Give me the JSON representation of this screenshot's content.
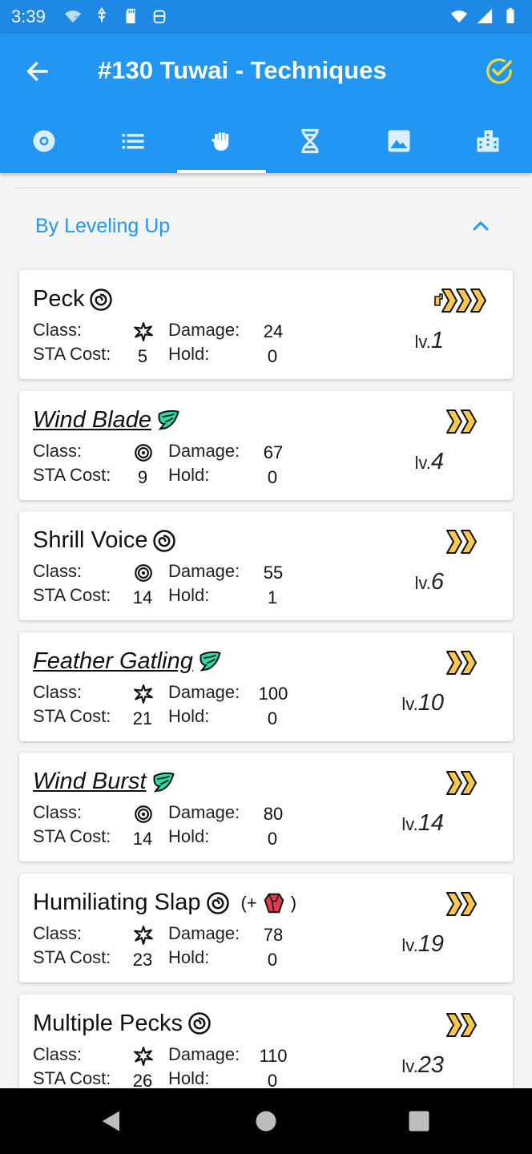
{
  "status_bar": {
    "time": "3:39",
    "icons_left": [
      "wifi-question-icon",
      "usb-debug-icon",
      "sd-card-icon",
      "android-icon"
    ],
    "icons_right": [
      "wifi-signal-icon",
      "cell-signal-icon",
      "battery-icon"
    ]
  },
  "app_bar": {
    "title": "#130 Tuwai - Techniques",
    "back_icon": "arrow-back-icon",
    "action_icon": "check-circle-icon",
    "accent_color": "#FDD835"
  },
  "tabs": [
    {
      "icon": "pokeball-icon",
      "active": false
    },
    {
      "icon": "list-icon",
      "active": false
    },
    {
      "icon": "fist-icon",
      "active": true
    },
    {
      "icon": "dna-icon",
      "active": false
    },
    {
      "icon": "image-icon",
      "active": false
    },
    {
      "icon": "building-icon",
      "active": false
    }
  ],
  "section": {
    "title": "By Leveling Up",
    "expanded": true
  },
  "labels": {
    "class": "Class:",
    "damage": "Damage:",
    "sta_cost": "STA Cost:",
    "hold": "Hold:",
    "level_prefix": "lv."
  },
  "techniques": [
    {
      "name": "Peck",
      "italic": false,
      "type": "wind",
      "extra": null,
      "class": "physical",
      "damage": "24",
      "sta_cost": "5",
      "hold": "0",
      "level": "1",
      "priority": "fast"
    },
    {
      "name": "Wind Blade",
      "italic": true,
      "type": "wind-green",
      "extra": null,
      "class": "special",
      "damage": "67",
      "sta_cost": "9",
      "hold": "0",
      "level": "4",
      "priority": "normal"
    },
    {
      "name": "Shrill Voice",
      "italic": false,
      "type": "wind",
      "extra": null,
      "class": "special",
      "damage": "55",
      "sta_cost": "14",
      "hold": "1",
      "level": "6",
      "priority": "normal"
    },
    {
      "name": "Feather Gatling",
      "italic": true,
      "type": "wind-green",
      "extra": null,
      "class": "physical",
      "damage": "100",
      "sta_cost": "21",
      "hold": "0",
      "level": "10",
      "priority": "normal"
    },
    {
      "name": "Wind Burst",
      "italic": true,
      "type": "wind-green",
      "extra": null,
      "class": "special",
      "damage": "80",
      "sta_cost": "14",
      "hold": "0",
      "level": "14",
      "priority": "normal"
    },
    {
      "name": "Humiliating Slap",
      "italic": false,
      "type": "wind",
      "extra": {
        "open": "(+",
        "icon": "crystal-icon",
        "close": ")"
      },
      "class": "physical",
      "damage": "78",
      "sta_cost": "23",
      "hold": "0",
      "level": "19",
      "priority": "normal"
    },
    {
      "name": "Multiple Pecks",
      "italic": false,
      "type": "wind",
      "extra": null,
      "class": "physical",
      "damage": "110",
      "sta_cost": "26",
      "hold": "0",
      "level": "23",
      "priority": "normal"
    }
  ],
  "colors": {
    "primary": "#2196F3",
    "status_bar": "#1E88E5",
    "speed_arrows": "#F9C74F",
    "wind_green": "#2ED8A8",
    "crystal_red": "#E53950"
  },
  "nav_bar": {
    "icons": [
      "back-triangle-icon",
      "home-circle-icon",
      "recents-square-icon"
    ]
  }
}
